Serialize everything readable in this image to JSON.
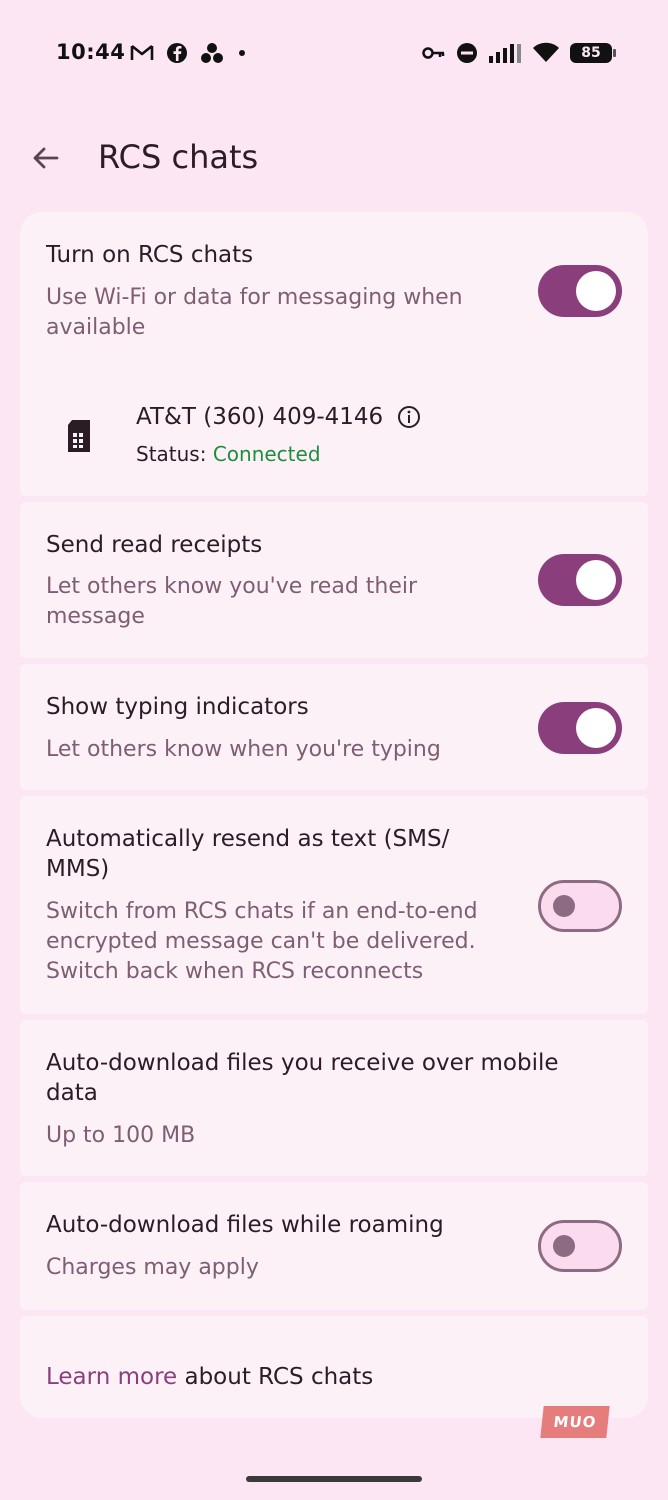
{
  "status_bar": {
    "time": "10:44",
    "left_icons": [
      "gmail-icon",
      "facebook-icon",
      "dots-cluster-icon",
      "dot-icon"
    ],
    "right_icons": [
      "vpn-key-icon",
      "do-not-disturb-icon",
      "signal-icon",
      "wifi-icon"
    ],
    "battery": "85"
  },
  "header": {
    "title": "RCS chats"
  },
  "rcs": {
    "title": "Turn on RCS chats",
    "subtitle_line1": "Use Wi-Fi or data for messaging when",
    "subtitle_line2": "available",
    "enabled": true,
    "carrier": "AT&T (360) 409-4146",
    "status_label": "Status:",
    "status_value": "Connected"
  },
  "read_receipts": {
    "title": "Send read receipts",
    "subtitle_line1": "Let others know you've read their",
    "subtitle_line2": "message",
    "enabled": true
  },
  "typing": {
    "title": "Show typing indicators",
    "subtitle": "Let others know when you're typing",
    "enabled": true
  },
  "resend": {
    "title_line1": "Automatically resend as text (SMS/",
    "title_line2": "MMS)",
    "subtitle_line1": "Switch from RCS chats if an end-to-end",
    "subtitle_line2": "encrypted message can't be delivered.",
    "subtitle_line3": "Switch back when RCS reconnects",
    "enabled": false
  },
  "autodownload_mobile": {
    "title_line1": "Auto-download files you receive over mobile",
    "title_line2": "data",
    "subtitle": "Up to 100 MB"
  },
  "autodownload_roaming": {
    "title": "Auto-download files while roaming",
    "subtitle": "Charges may apply",
    "enabled": false
  },
  "footer": {
    "link_text": "Learn more",
    "rest_text": " about RCS chats"
  },
  "watermark": "MUO",
  "colors": {
    "accent": "#8a3f7c",
    "background": "#fce6f3",
    "card": "#fdf1f8",
    "connected": "#1e8e3e"
  }
}
